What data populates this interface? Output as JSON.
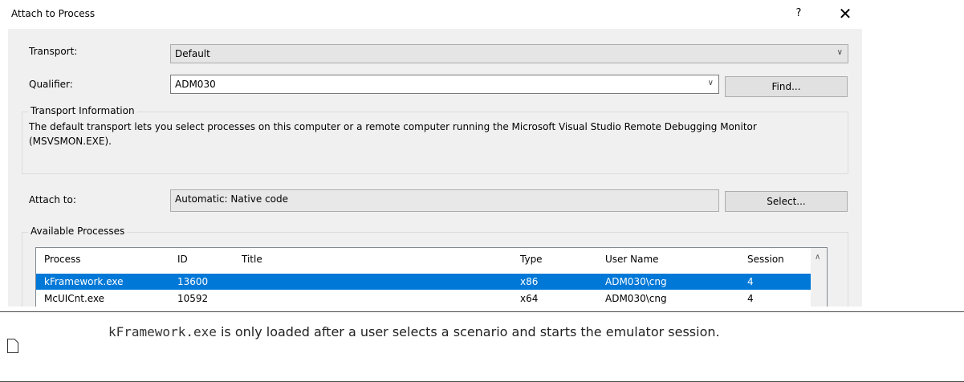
{
  "window": {
    "title": "Attach to Process",
    "help_label": "?",
    "close_label": "✕"
  },
  "transport": {
    "label": "Transport:",
    "value": "Default"
  },
  "qualifier": {
    "label": "Qualifier:",
    "value": "ADM030",
    "find_button": "Find..."
  },
  "transport_info": {
    "title": "Transport Information",
    "text": "The default transport lets you select processes on this computer or a remote computer running the Microsoft Visual Studio Remote Debugging Monitor (MSVSMON.EXE)."
  },
  "attach_to": {
    "label": "Attach to:",
    "value": "Automatic: Native code",
    "select_button": "Select..."
  },
  "processes": {
    "group_title": "Available Processes",
    "columns": [
      "Process",
      "ID",
      "Title",
      "Type",
      "User Name",
      "Session"
    ],
    "rows": [
      {
        "process": "kFramework.exe",
        "id": "13600",
        "title": "",
        "type": "x86",
        "user": "ADM030\\cng",
        "session": "4",
        "selected": true
      },
      {
        "process": "McUICnt.exe",
        "id": "10592",
        "title": "",
        "type": "x64",
        "user": "ADM030\\cng",
        "session": "4",
        "selected": false
      }
    ]
  },
  "note": {
    "code": "kFramework.exe",
    "text": " is only loaded after a user selects a scenario and starts the emulator session."
  },
  "colors": {
    "selection": "#0078d7",
    "panel": "#f0f0f0"
  }
}
